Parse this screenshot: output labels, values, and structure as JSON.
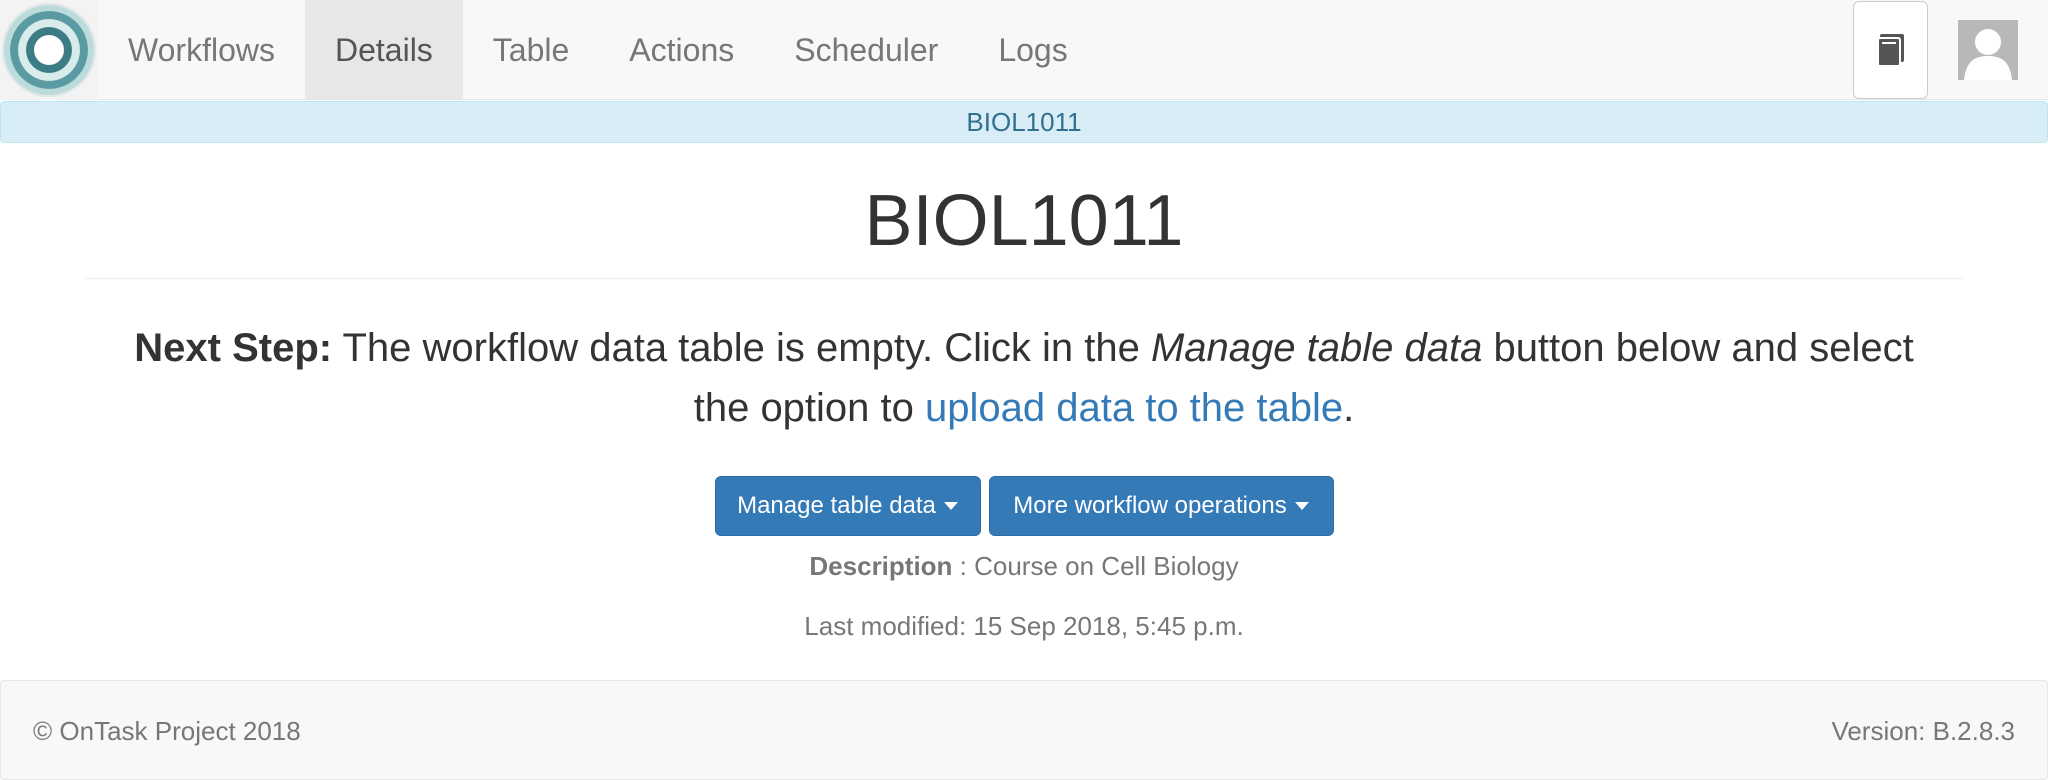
{
  "navbar": {
    "logo_icon": "ontask-logo-icon",
    "items": [
      {
        "label": "Workflows",
        "active": false
      },
      {
        "label": "Details",
        "active": true
      },
      {
        "label": "Table",
        "active": false
      },
      {
        "label": "Actions",
        "active": false
      },
      {
        "label": "Scheduler",
        "active": false
      },
      {
        "label": "Logs",
        "active": false
      }
    ],
    "right_icons": [
      "book-icon",
      "user-avatar-icon"
    ]
  },
  "context_bar": {
    "label": "BIOL1011"
  },
  "main": {
    "title": "BIOL1011",
    "next_step": {
      "label": "Next Step:",
      "text1": " The workflow data table is empty. Click in the ",
      "emph": "Manage table data",
      "text2": " button below and select the option to ",
      "link": "upload data to the table",
      "text3": "."
    },
    "buttons": {
      "manage_table": "Manage table data",
      "more_ops": "More workflow operations"
    },
    "description": {
      "label": "Description",
      "separator": " : ",
      "value": "Course on Cell Biology"
    },
    "last_modified": "Last modified: 15 Sep 2018, 5:45 p.m."
  },
  "footer": {
    "copyright": "© OnTask Project 2018",
    "version": "Version: B.2.8.3"
  },
  "colors": {
    "primary": "#337ab7",
    "info_bg": "#d9edf7",
    "info_text": "#31708f",
    "navbar_bg": "#f8f8f8"
  }
}
